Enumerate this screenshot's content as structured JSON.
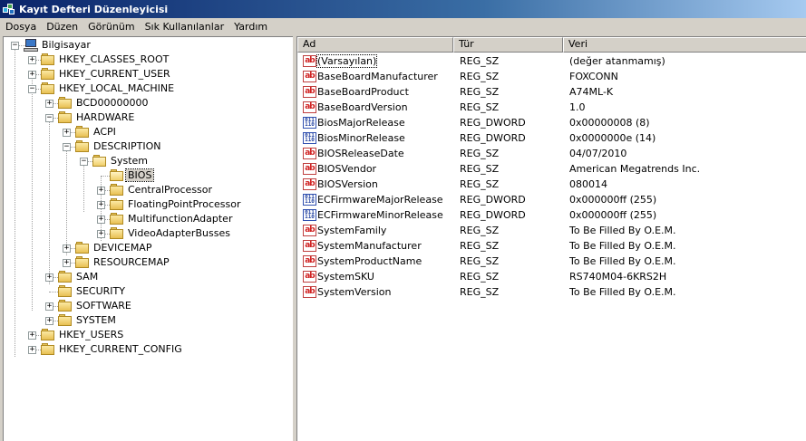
{
  "window": {
    "title": "Kayıt Defteri Düzenleyicisi"
  },
  "menu": [
    "Dosya",
    "Düzen",
    "Görünüm",
    "Sık Kullanılanlar",
    "Yardım"
  ],
  "tree": [
    {
      "label": "Bilgisayar",
      "expander": "−",
      "icon": "computer-icon"
    },
    {
      "label": "HKEY_CLASSES_ROOT",
      "expander": "+",
      "icon": "folder-icon"
    },
    {
      "label": "HKEY_CURRENT_USER",
      "expander": "+",
      "icon": "folder-icon"
    },
    {
      "label": "HKEY_LOCAL_MACHINE",
      "expander": "−",
      "icon": "folder-icon"
    },
    {
      "label": "BCD00000000",
      "expander": "+",
      "icon": "folder-icon"
    },
    {
      "label": "HARDWARE",
      "expander": "−",
      "icon": "folder-icon"
    },
    {
      "label": "ACPI",
      "expander": "+",
      "icon": "folder-icon"
    },
    {
      "label": "DESCRIPTION",
      "expander": "−",
      "icon": "folder-icon"
    },
    {
      "label": "System",
      "expander": "−",
      "icon": "folder-open-icon"
    },
    {
      "label": "BIOS",
      "expander": "",
      "icon": "folder-open-icon",
      "selected": true
    },
    {
      "label": "CentralProcessor",
      "expander": "+",
      "icon": "folder-icon"
    },
    {
      "label": "FloatingPointProcessor",
      "expander": "+",
      "icon": "folder-icon"
    },
    {
      "label": "MultifunctionAdapter",
      "expander": "+",
      "icon": "folder-icon"
    },
    {
      "label": "VideoAdapterBusses",
      "expander": "+",
      "icon": "folder-icon"
    },
    {
      "label": "DEVICEMAP",
      "expander": "+",
      "icon": "folder-icon"
    },
    {
      "label": "RESOURCEMAP",
      "expander": "+",
      "icon": "folder-icon"
    },
    {
      "label": "SAM",
      "expander": "+",
      "icon": "folder-icon"
    },
    {
      "label": "SECURITY",
      "expander": "",
      "icon": "folder-icon"
    },
    {
      "label": "SOFTWARE",
      "expander": "+",
      "icon": "folder-icon"
    },
    {
      "label": "SYSTEM",
      "expander": "+",
      "icon": "folder-icon"
    },
    {
      "label": "HKEY_USERS",
      "expander": "+",
      "icon": "folder-icon"
    },
    {
      "label": "HKEY_CURRENT_CONFIG",
      "expander": "+",
      "icon": "folder-icon"
    }
  ],
  "columns": {
    "name": "Ad",
    "type": "Tür",
    "data": "Veri"
  },
  "values": [
    {
      "icon": "string-value-icon",
      "name": "(Varsayılan)",
      "type": "REG_SZ",
      "data": "(değer atanmamış)",
      "selected": true
    },
    {
      "icon": "string-value-icon",
      "name": "BaseBoardManufacturer",
      "type": "REG_SZ",
      "data": "FOXCONN"
    },
    {
      "icon": "string-value-icon",
      "name": "BaseBoardProduct",
      "type": "REG_SZ",
      "data": "A74ML-K"
    },
    {
      "icon": "string-value-icon",
      "name": "BaseBoardVersion",
      "type": "REG_SZ",
      "data": "1.0"
    },
    {
      "icon": "binary-value-icon",
      "name": "BiosMajorRelease",
      "type": "REG_DWORD",
      "data": "0x00000008 (8)"
    },
    {
      "icon": "binary-value-icon",
      "name": "BiosMinorRelease",
      "type": "REG_DWORD",
      "data": "0x0000000e (14)"
    },
    {
      "icon": "string-value-icon",
      "name": "BIOSReleaseDate",
      "type": "REG_SZ",
      "data": "04/07/2010"
    },
    {
      "icon": "string-value-icon",
      "name": "BIOSVendor",
      "type": "REG_SZ",
      "data": "American Megatrends Inc."
    },
    {
      "icon": "string-value-icon",
      "name": "BIOSVersion",
      "type": "REG_SZ",
      "data": "080014"
    },
    {
      "icon": "binary-value-icon",
      "name": "ECFirmwareMajorRelease",
      "type": "REG_DWORD",
      "data": "0x000000ff (255)"
    },
    {
      "icon": "binary-value-icon",
      "name": "ECFirmwareMinorRelease",
      "type": "REG_DWORD",
      "data": "0x000000ff (255)"
    },
    {
      "icon": "string-value-icon",
      "name": "SystemFamily",
      "type": "REG_SZ",
      "data": "To Be Filled By O.E.M."
    },
    {
      "icon": "string-value-icon",
      "name": "SystemManufacturer",
      "type": "REG_SZ",
      "data": "To Be Filled By O.E.M."
    },
    {
      "icon": "string-value-icon",
      "name": "SystemProductName",
      "type": "REG_SZ",
      "data": "To Be Filled By O.E.M."
    },
    {
      "icon": "string-value-icon",
      "name": "SystemSKU",
      "type": "REG_SZ",
      "data": "RS740M04-6KRS2H"
    },
    {
      "icon": "string-value-icon",
      "name": "SystemVersion",
      "type": "REG_SZ",
      "data": "To Be Filled By O.E.M."
    }
  ],
  "icon_glyphs": {
    "string": "ab",
    "binary": "011 110"
  },
  "colors": {
    "title_gradient_start": "#0a246a",
    "title_gradient_end": "#a6caf0",
    "chrome": "#d4d0c8"
  }
}
